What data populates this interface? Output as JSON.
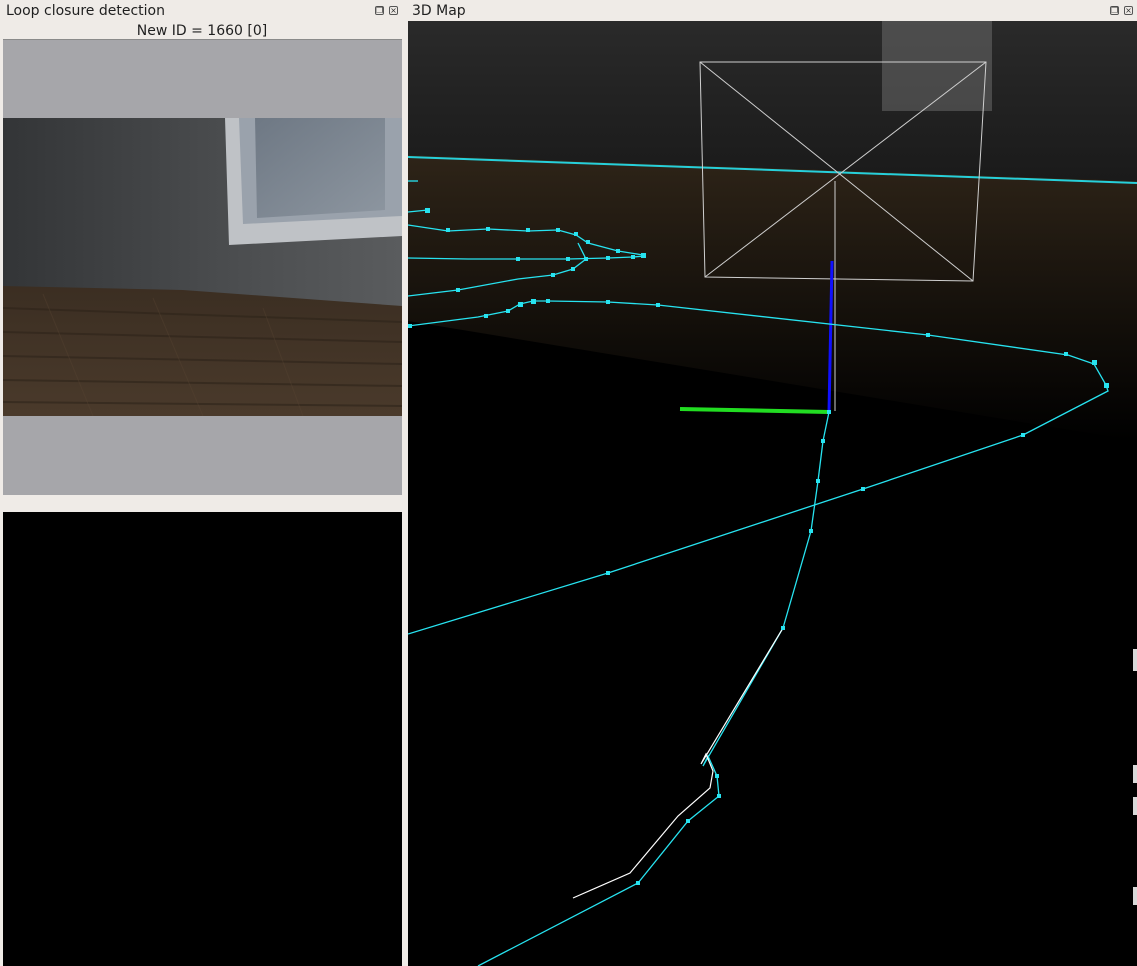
{
  "left_dock": {
    "title": "Loop closure detection",
    "status": "New ID = 1660 [0]",
    "float_icon": "float-icon",
    "close_icon": "close-icon"
  },
  "right_dock": {
    "title": "3D Map",
    "float_icon": "float-icon",
    "close_icon": "close-icon"
  },
  "colors": {
    "trajectory": "#27e3f0",
    "axis_z": "#1010ff",
    "axis_y": "#22dd22",
    "frustum": "#cfcfcf",
    "panel_bg": "#efebe7",
    "image_bg": "#a6a6aa"
  }
}
